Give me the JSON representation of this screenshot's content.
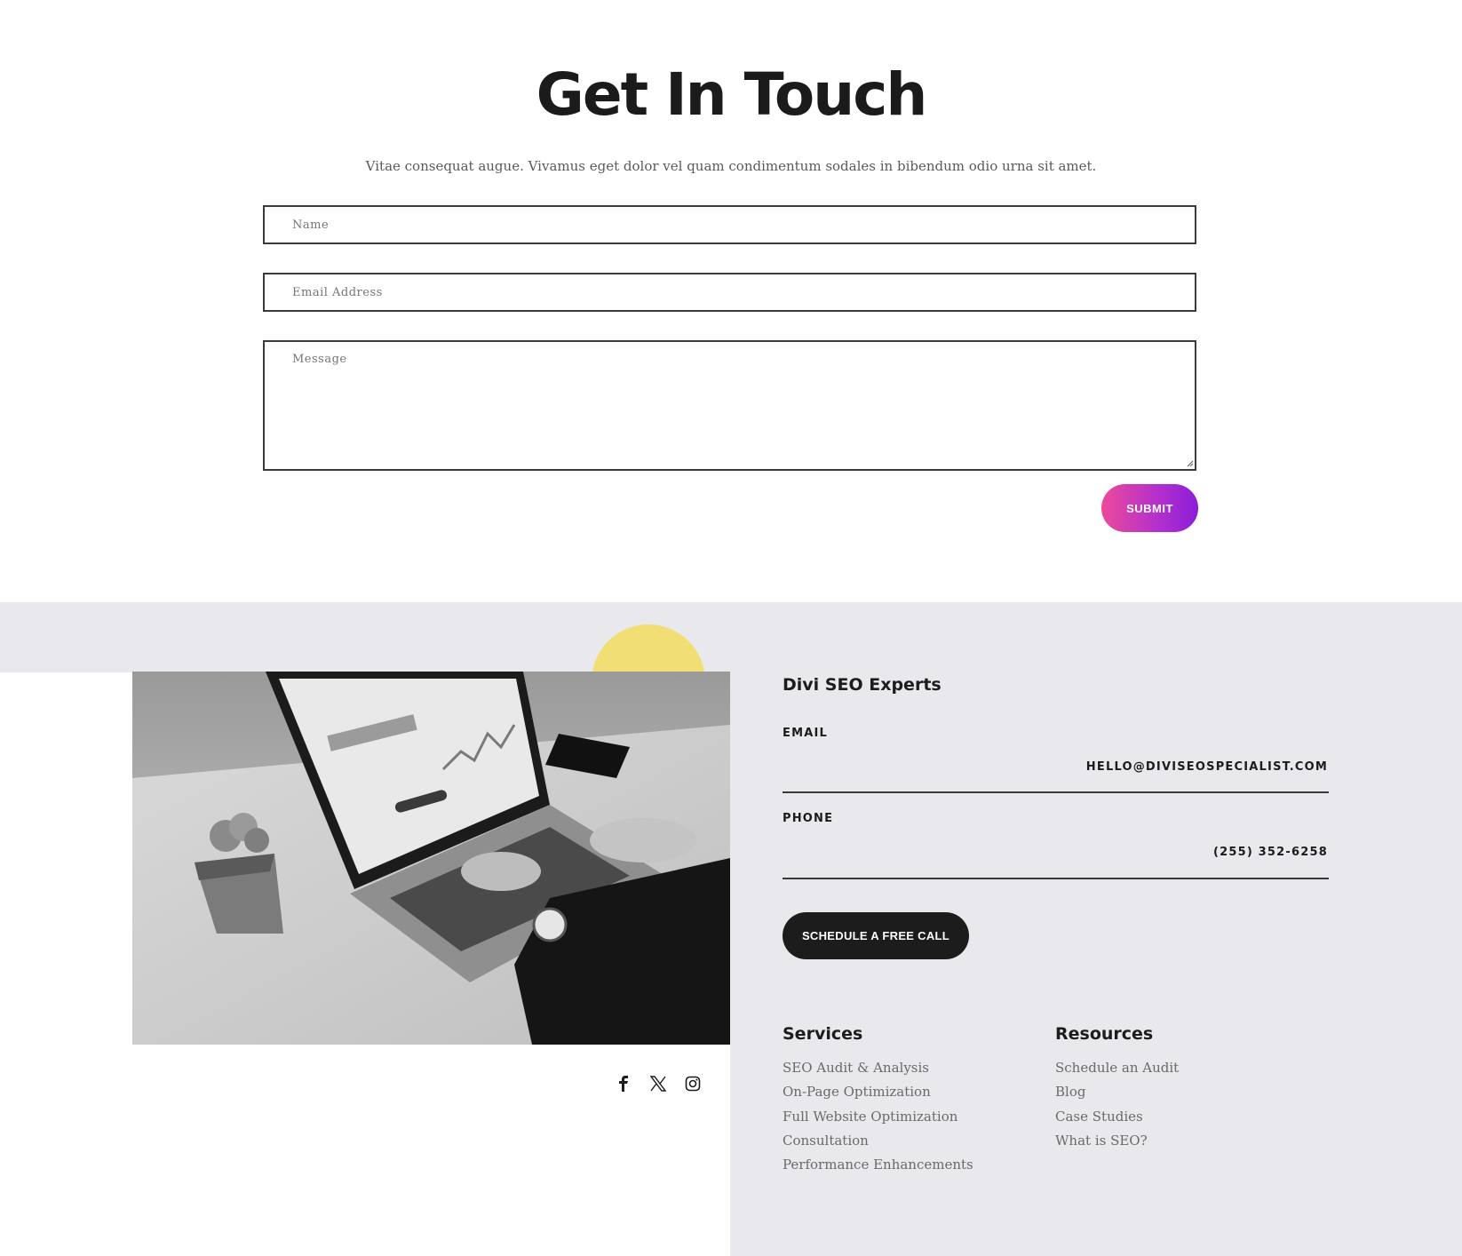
{
  "contact": {
    "title": "Get In Touch",
    "intro": "Vitae consequat augue. Vivamus eget dolor vel quam condimentum sodales in bibendum odio urna sit amet.",
    "name_placeholder": "Name",
    "email_placeholder": "Email Address",
    "message_placeholder": "Message",
    "submit_label": "SUBMIT"
  },
  "footer": {
    "brand": "Divi SEO Experts",
    "email_label": "EMAIL",
    "email_value": "HELLO@DIVISEOSPECIALIST.COM",
    "phone_label": "PHONE",
    "phone_value": "(255) 352-6258",
    "cta_label": "SCHEDULE A FREE CALL",
    "services": {
      "title": "Services",
      "items": [
        "SEO Audit & Analysis",
        "On-Page Optimization",
        "Full Website Optimization",
        "Consultation",
        "Performance Enhancements"
      ]
    },
    "resources": {
      "title": "Resources",
      "items": [
        "Schedule an Audit",
        "Blog",
        "Case Studies",
        "What is SEO?"
      ]
    },
    "social_icons": [
      "facebook-icon",
      "x-twitter-icon",
      "instagram-icon"
    ]
  },
  "colors": {
    "submit_gradient_start": "#ec4a9b",
    "submit_gradient_end": "#8b1dd8",
    "footer_background": "#e8e8ed",
    "accent_yellow": "#f1df75",
    "dark": "#1c1c1c"
  }
}
